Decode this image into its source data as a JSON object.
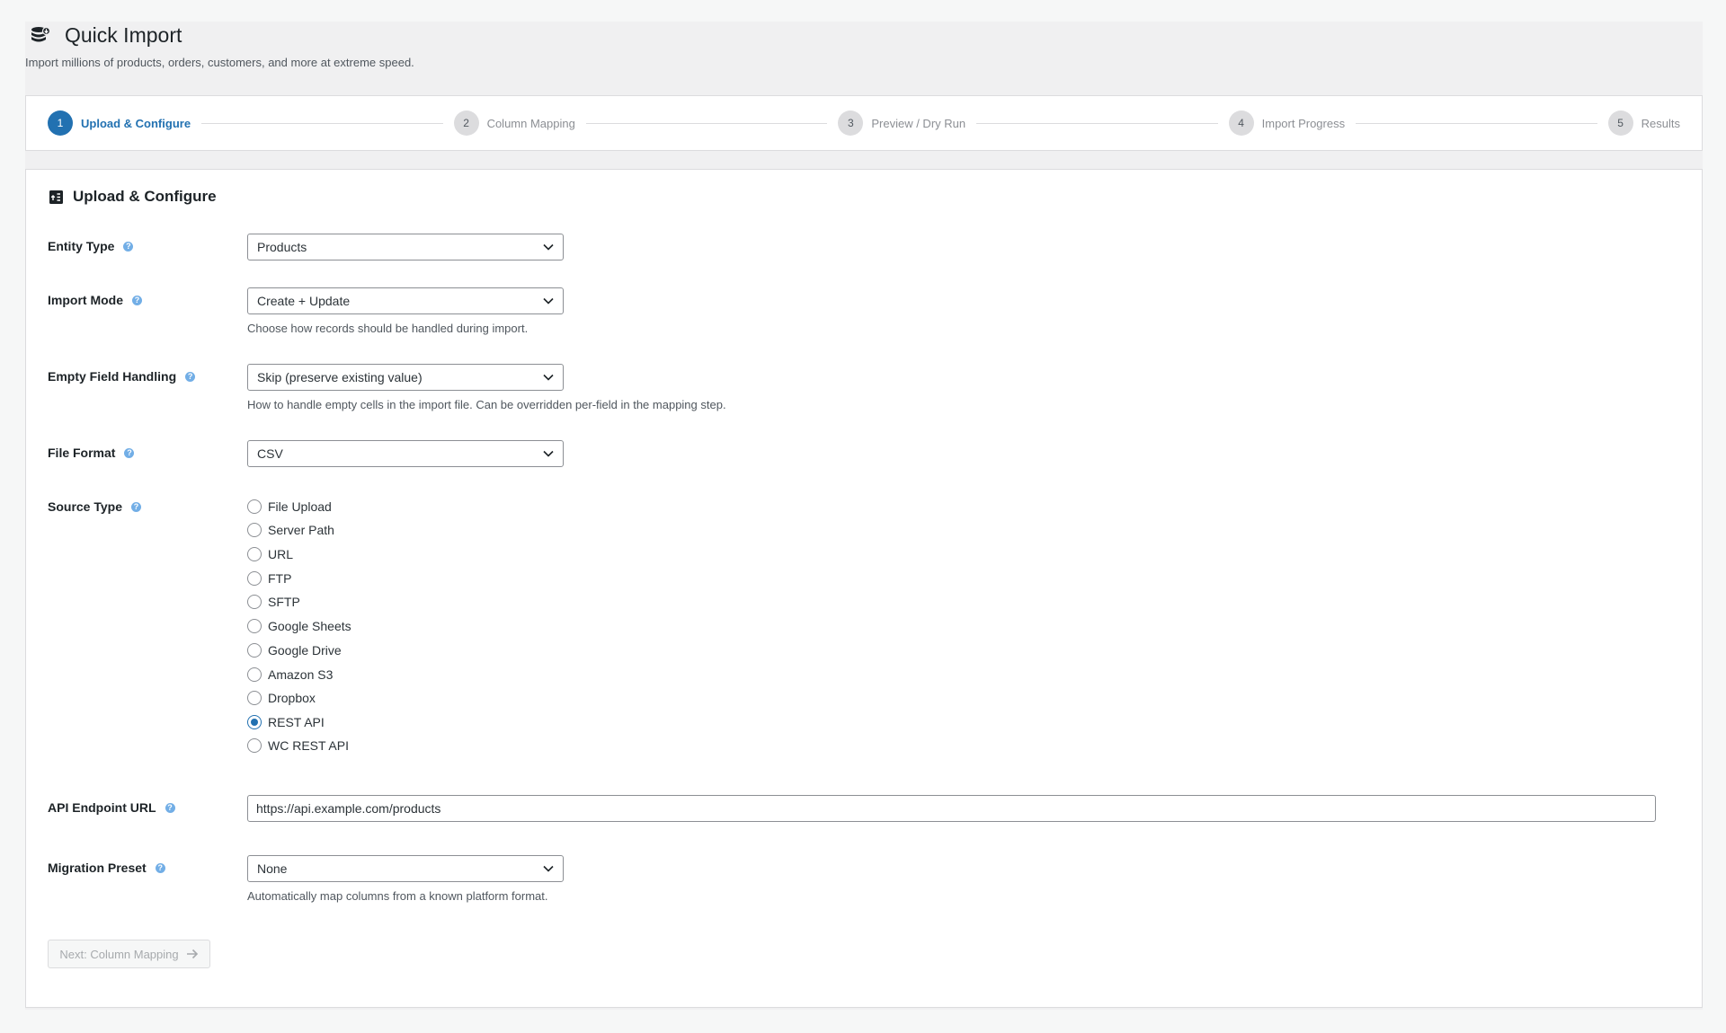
{
  "header": {
    "title": "Quick Import",
    "subtitle": "Import millions of products, orders, customers, and more at extreme speed.",
    "icon": "database-icon"
  },
  "steps": [
    {
      "num": "1",
      "label": "Upload & Configure",
      "active": true
    },
    {
      "num": "2",
      "label": "Column Mapping",
      "active": false
    },
    {
      "num": "3",
      "label": "Preview / Dry Run",
      "active": false
    },
    {
      "num": "4",
      "label": "Import Progress",
      "active": false
    },
    {
      "num": "5",
      "label": "Results",
      "active": false
    }
  ],
  "card": {
    "title": "Upload & Configure",
    "icon": "upload-box-icon"
  },
  "fields": {
    "entity_type": {
      "label": "Entity Type",
      "value": "Products"
    },
    "import_mode": {
      "label": "Import Mode",
      "value": "Create + Update",
      "description": "Choose how records should be handled during import."
    },
    "empty_field": {
      "label": "Empty Field Handling",
      "value": "Skip (preserve existing value)",
      "description": "How to handle empty cells in the import file. Can be overridden per-field in the mapping step."
    },
    "file_format": {
      "label": "File Format",
      "value": "CSV"
    },
    "source_type": {
      "label": "Source Type",
      "options": [
        "File Upload",
        "Server Path",
        "URL",
        "FTP",
        "SFTP",
        "Google Sheets",
        "Google Drive",
        "Amazon S3",
        "Dropbox",
        "REST API",
        "WC REST API"
      ],
      "selected": "REST API"
    },
    "api_endpoint": {
      "label": "API Endpoint URL",
      "value": "https://api.example.com/products"
    },
    "migration_preset": {
      "label": "Migration Preset",
      "value": "None",
      "description": "Automatically map columns from a known platform format."
    }
  },
  "actions": {
    "next_label": "Next: Column Mapping"
  },
  "colors": {
    "accent": "#2271b1",
    "help": "#72aee6"
  }
}
